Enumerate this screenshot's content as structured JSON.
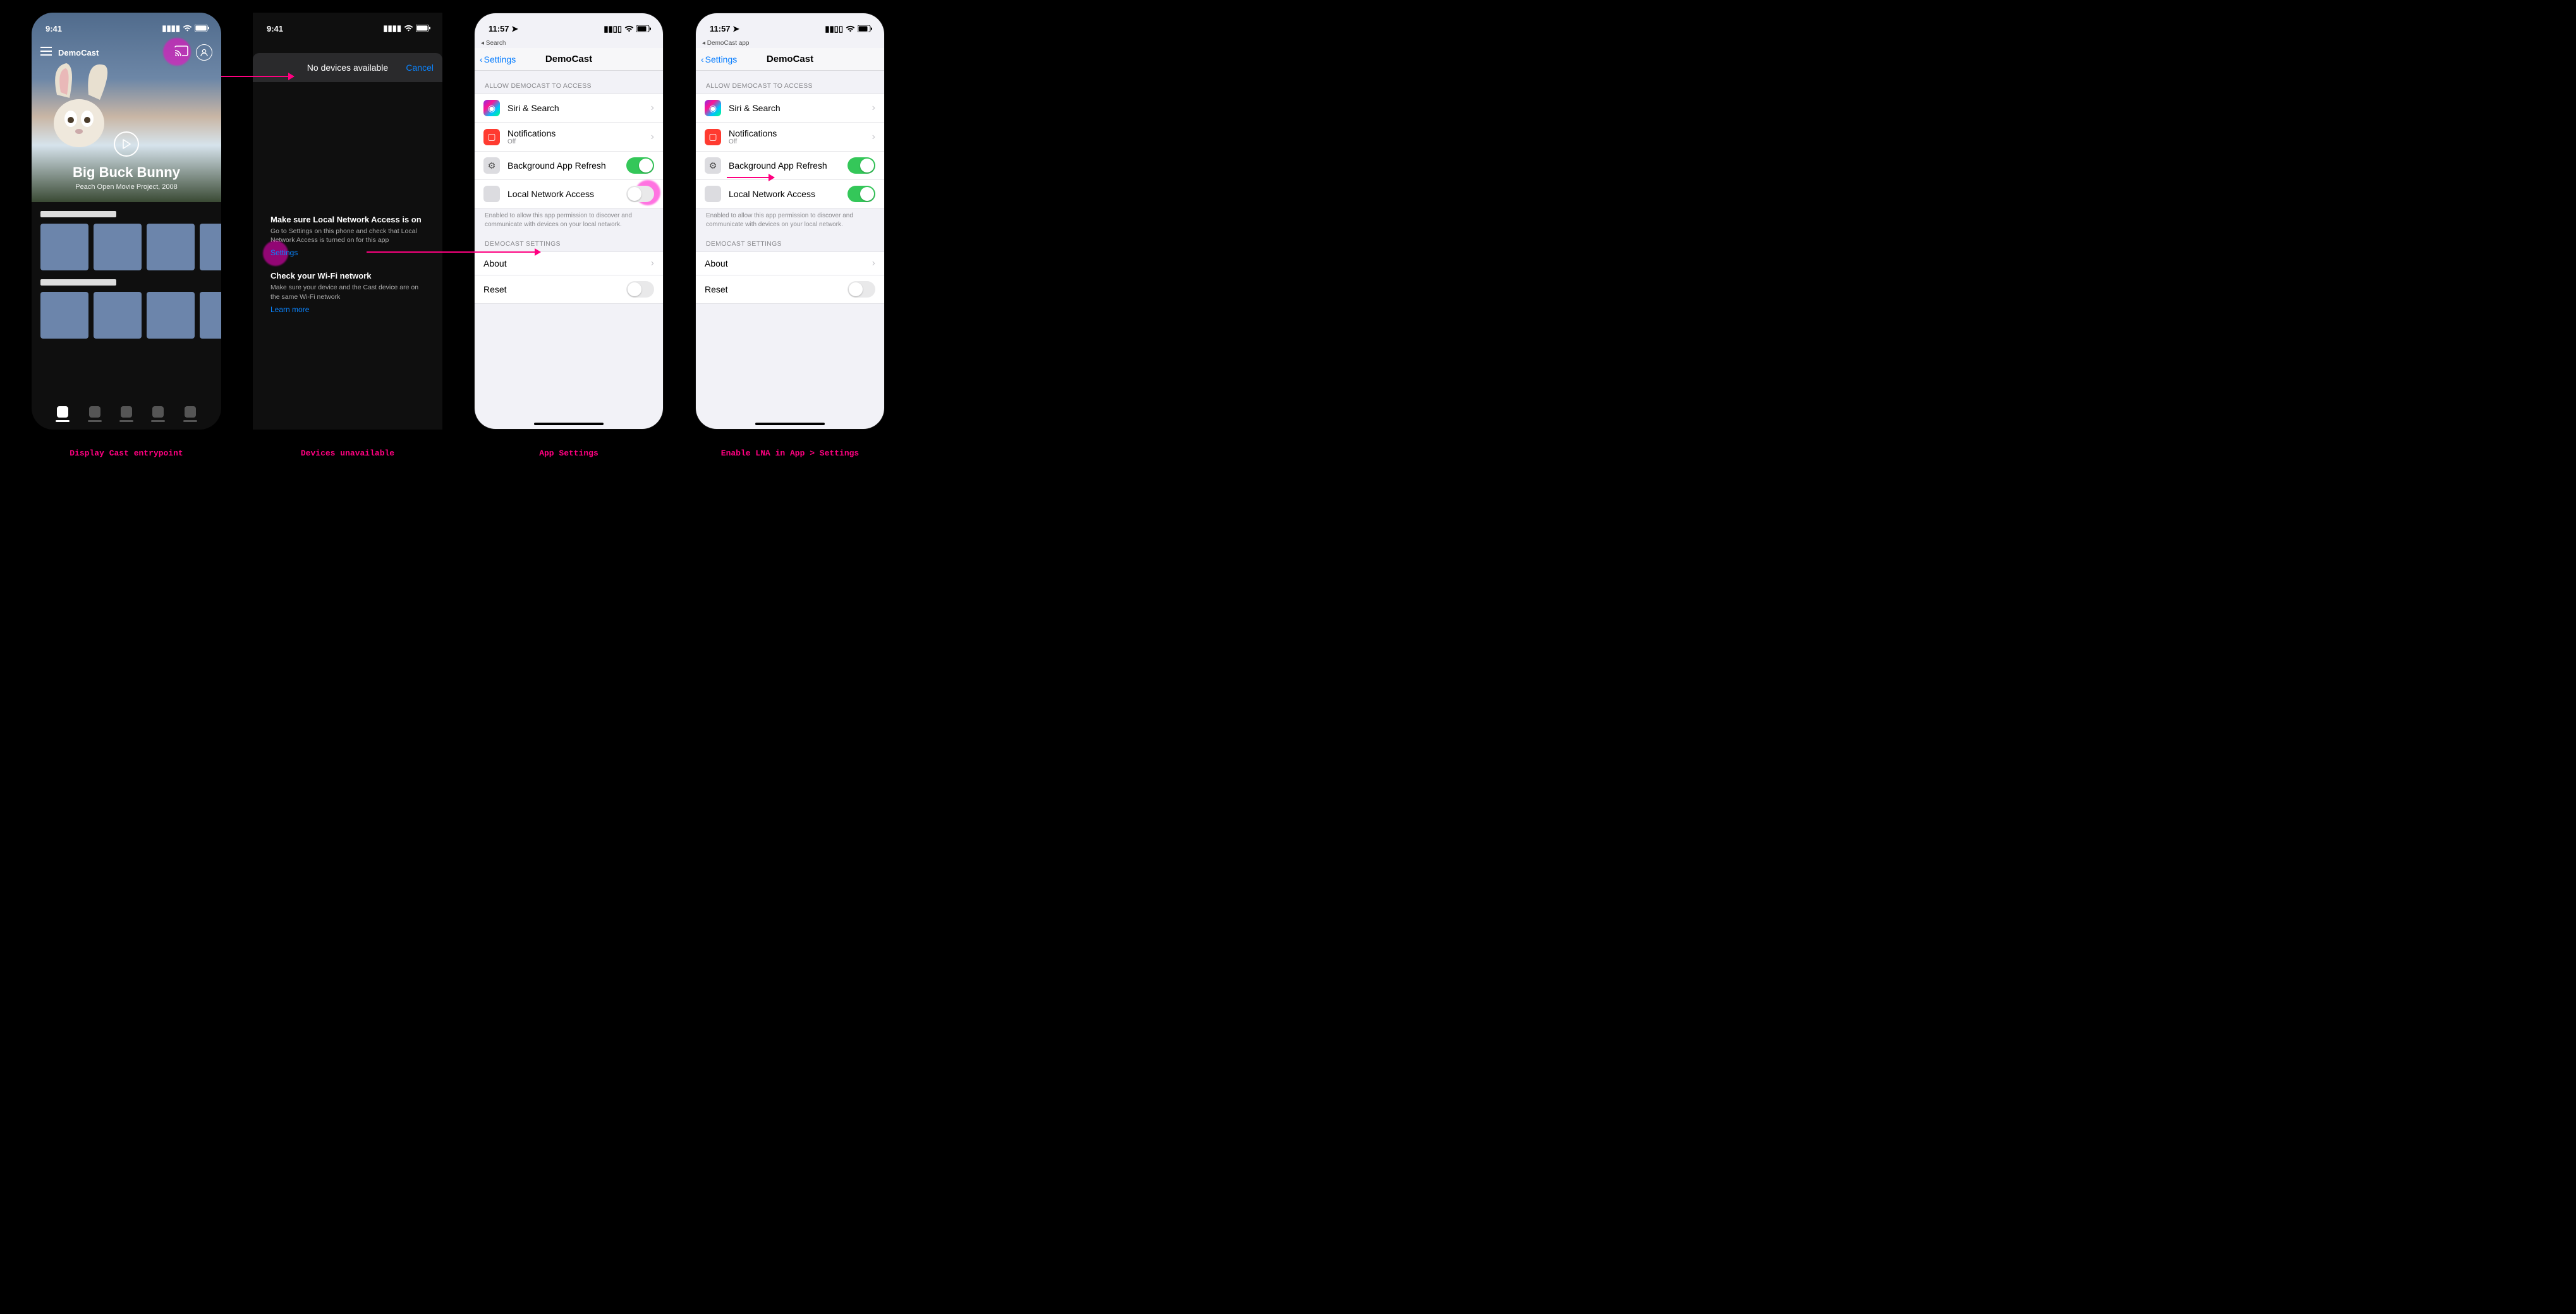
{
  "status": {
    "time_941": "9:41",
    "time_1157": "11:57",
    "breadcrumb_search": "◂ Search",
    "breadcrumb_app": "◂ DemoCast app"
  },
  "phone1": {
    "app_name": "DemoCast",
    "movie_title": "Big Buck Bunny",
    "movie_subtitle": "Peach Open Movie Project, 2008"
  },
  "phone2": {
    "sheet_title": "No devices available",
    "cancel": "Cancel",
    "lna_heading": "Make sure Local Network Access is on",
    "lna_body": "Go to Settings on this phone and check that Local Network Access is turned on for this app",
    "settings_link": "Settings",
    "wifi_heading": "Check your Wi-Fi network",
    "wifi_body": "Make sure your device and the Cast device are on the same Wi-Fi network",
    "learn_more": "Learn more"
  },
  "settings_common": {
    "nav_back": "Settings",
    "nav_title": "DemoCast",
    "group_access": "ALLOW DEMOCAST TO ACCESS",
    "row_siri": "Siri & Search",
    "row_notif": "Notifications",
    "row_notif_sub": "Off",
    "row_bg": "Background App Refresh",
    "row_lna": "Local Network Access",
    "lna_footer": "Enabled to allow this app permission to discover and communicate with devices on your local network.",
    "group_app": "DEMOCAST SETTINGS",
    "row_about": "About",
    "row_reset": "Reset"
  },
  "captions": {
    "c1": "Display Cast entrypoint",
    "c2": "Devices unavailable",
    "c3": "App Settings",
    "c4": "Enable LNA in App > Settings"
  },
  "colors": {
    "accent_pink": "#ff0080",
    "ios_blue": "#007aff",
    "ios_green": "#34c759"
  }
}
